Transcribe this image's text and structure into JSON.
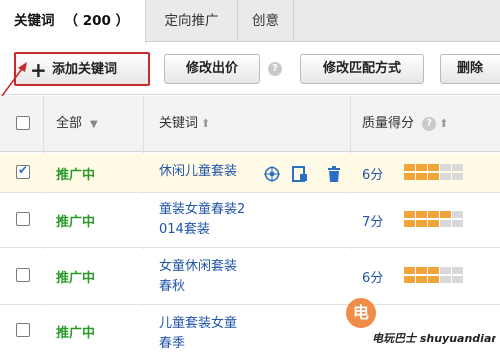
{
  "tabs": [
    {
      "label": "关键词",
      "count": "（ 200 ）",
      "active": true
    },
    {
      "label": "定向推广",
      "active": false
    },
    {
      "label": "创意",
      "active": false
    }
  ],
  "toolbar": {
    "add_label": "添加关键词",
    "bid_label": "修改出价",
    "help": "?",
    "match_label": "修改匹配方式",
    "delete_label": "删除"
  },
  "table": {
    "headers": {
      "status": "全部",
      "keyword": "关键词",
      "quality": "质量得分"
    },
    "rows": [
      {
        "checked": true,
        "status": "推广中",
        "keyword_line1": "休闲儿童套装",
        "keyword_line2": "",
        "score": "6分",
        "filled": 6
      },
      {
        "checked": false,
        "status": "推广中",
        "keyword_line1": "童装女童春装2",
        "keyword_line2": "014套装",
        "score": "7分",
        "filled": 7
      },
      {
        "checked": false,
        "status": "推广中",
        "keyword_line1": "女童休闲套装",
        "keyword_line2": "春秋",
        "score": "6分",
        "filled": 6
      },
      {
        "checked": false,
        "status": "推广中",
        "keyword_line1": "儿童套装女童",
        "keyword_line2": "春季",
        "score": "",
        "filled": 0
      }
    ]
  },
  "colors": {
    "accent_red": "#c62b2b",
    "status_green": "#2a9a2a",
    "link_blue": "#2155a8",
    "quality_orange": "#f0a538"
  },
  "watermark": "电玩巴士 shuyuandianzi.com"
}
